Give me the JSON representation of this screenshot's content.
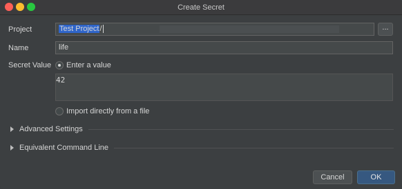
{
  "window": {
    "title": "Create Secret"
  },
  "form": {
    "project_label": "Project",
    "project_value": "Test Project",
    "project_suffix": "/",
    "browse_label": "...",
    "name_label": "Name",
    "name_value": "life",
    "secret_value_label": "Secret Value",
    "enter_value_option": "Enter a value",
    "secret_text": "42",
    "import_option": "Import directly from a file"
  },
  "sections": {
    "advanced": "Advanced Settings",
    "command_line": "Equivalent Command Line"
  },
  "buttons": {
    "cancel": "Cancel",
    "ok": "OK"
  }
}
